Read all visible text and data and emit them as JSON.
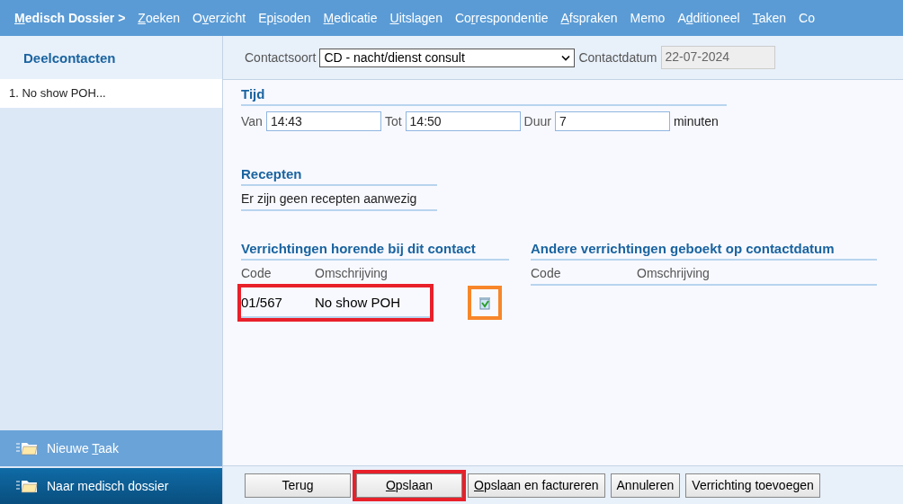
{
  "nav": [
    {
      "key": "M",
      "after": "edisch Dossier >",
      "selected": true
    },
    {
      "key": "Z",
      "after": "oeken",
      "selected": false
    },
    {
      "before": "O",
      "key": "v",
      "after": "erzicht",
      "selected": false
    },
    {
      "before": "Ep",
      "key": "i",
      "after": "soden",
      "selected": false
    },
    {
      "key": "M",
      "after": "edicatie",
      "selected": false
    },
    {
      "key": "U",
      "after": "itslagen",
      "selected": false
    },
    {
      "before": "Co",
      "key": "r",
      "after": "respondentie",
      "selected": false
    },
    {
      "key": "A",
      "after": "fspraken",
      "selected": false
    },
    {
      "before": "Memo",
      "selected": false
    },
    {
      "before": "A",
      "key": "d",
      "after": "ditioneel",
      "selected": false
    },
    {
      "key": "T",
      "after": "aken",
      "selected": false
    },
    {
      "before": "Co",
      "selected": false
    }
  ],
  "sidebar": {
    "title": "Deelcontacten",
    "items": [
      {
        "label": "1. No show POH...",
        "selected": true
      }
    ],
    "actions": [
      {
        "kind": "light",
        "before": "Nieuwe ",
        "key": "T",
        "after": "aak"
      },
      {
        "kind": "dark",
        "before": "Naar medisch dossier"
      }
    ]
  },
  "contact": {
    "type_label": "Contactsoort",
    "type_value": "CD - nacht/dienst consult",
    "date_label": "Contactdatum",
    "date_value": "22-07-2024"
  },
  "tijd": {
    "title": "Tijd",
    "fields": [
      {
        "label": "Van",
        "value": "14:43"
      },
      {
        "label": "Tot",
        "value": "14:50"
      },
      {
        "label": "Duur",
        "value": "7"
      }
    ],
    "unit": "minuten"
  },
  "recepten": {
    "title": "Recepten",
    "text": "Er zijn geen recepten aanwezig"
  },
  "verrichtingen": {
    "title": "Verrichtingen horende bij dit contact",
    "columns": [
      "Code",
      "Omschrijving"
    ],
    "rows": [
      {
        "code": "01/567",
        "description": "No show POH",
        "highlighted": true,
        "icon_highlighted": true
      }
    ]
  },
  "andere": {
    "title": "Andere verrichtingen geboekt op contactdatum",
    "columns": [
      "Code",
      "Omschrijving"
    ]
  },
  "buttons": [
    {
      "before": "Terug",
      "highlighted": false
    },
    {
      "key": "O",
      "after": "pslaan",
      "highlighted": true
    },
    {
      "key": "O",
      "after": "pslaan en factureren",
      "highlighted": false
    },
    {
      "before": "Annuleren",
      "highlighted": false
    },
    {
      "before": "Verrichting toevoegen",
      "highlighted": false
    }
  ]
}
